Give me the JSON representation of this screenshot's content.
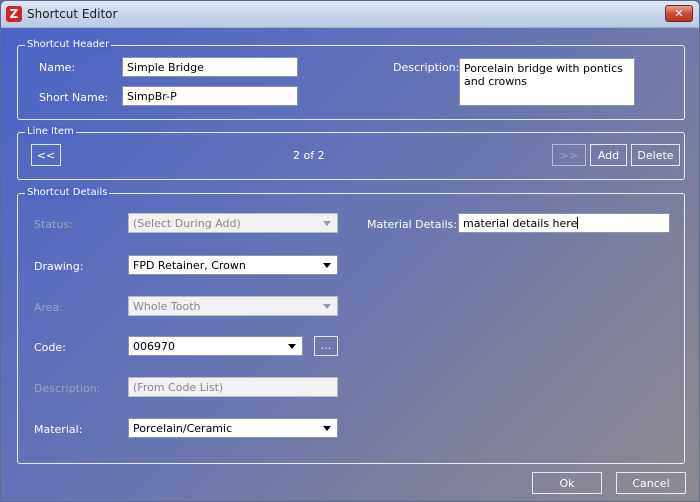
{
  "window": {
    "title": "Shortcut Editor",
    "close_glyph": "✕",
    "app_icon": "Z"
  },
  "header_group": {
    "legend": "Shortcut Header",
    "name_label": "Name:",
    "name_value": "Simple Bridge",
    "short_name_label": "Short Name:",
    "short_name_value": "SimpBr-P",
    "description_label": "Description:",
    "description_value": "Porcelain bridge with pontics and crowns"
  },
  "line_item_group": {
    "legend": "Line Item",
    "prev_label": "<<",
    "counter": "2 of 2",
    "next_label": ">>",
    "add_label": "Add",
    "delete_label": "Delete"
  },
  "details_group": {
    "legend": "Shortcut Details",
    "status_label": "Status:",
    "status_value": "(Select During Add)",
    "material_details_label": "Material Details:",
    "material_details_value": "material details here",
    "drawing_label": "Drawing:",
    "drawing_value": "FPD Retainer, Crown",
    "area_label": "Area:",
    "area_value": "Whole Tooth",
    "code_label": "Code:",
    "code_value": "006970",
    "code_browse_label": "...",
    "description_label": "Description:",
    "description_placeholder": "(From Code List)",
    "material_label": "Material:",
    "material_value": "Porcelain/Ceramic"
  },
  "footer": {
    "ok_label": "Ok",
    "cancel_label": "Cancel"
  }
}
